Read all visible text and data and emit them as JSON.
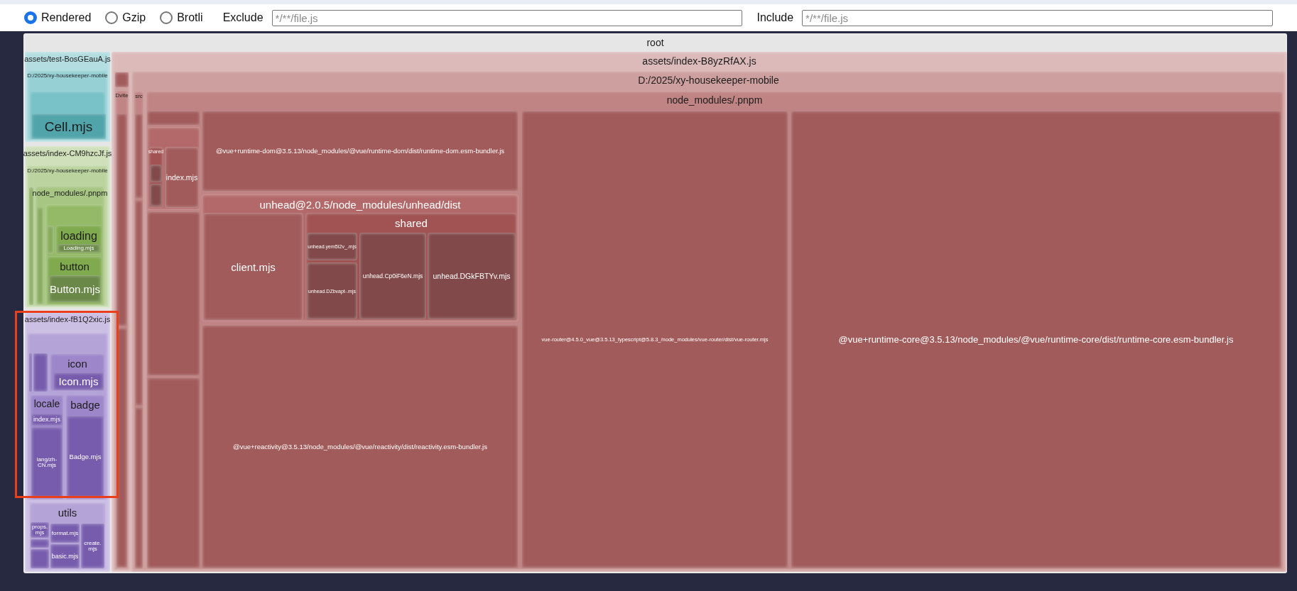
{
  "toolbar": {
    "size_options": [
      {
        "label": "Rendered",
        "selected": true
      },
      {
        "label": "Gzip",
        "selected": false
      },
      {
        "label": "Brotli",
        "selected": false
      }
    ],
    "filters": [
      {
        "label": "Exclude",
        "placeholder": "*/**/file.js"
      },
      {
        "label": "Include",
        "placeholder": "*/**/file.js"
      }
    ]
  },
  "treemap": {
    "root": {
      "kind": "folder",
      "label": "root",
      "children": [
        {
          "kind": "folder",
          "label": "assets/test-BosGEauA.js",
          "color": "#b3dde0",
          "highlighted": false,
          "children": [
            {
              "kind": "folder",
              "label": "D:/2025/xy-housekeeper-mobile",
              "children": [
                {
                  "kind": "folder",
                  "children": [
                    {
                      "kind": "module",
                      "label": "Cell.mjs"
                    }
                  ]
                }
              ]
            }
          ]
        },
        {
          "kind": "folder",
          "label": "assets/index-CM9hzcJf.js",
          "color": "#cfe0bb",
          "highlighted": false,
          "children": [
            {
              "kind": "folder",
              "label": "D:/2025/xy-housekeeper-mobile",
              "children": [
                {
                  "kind": "module"
                },
                {
                  "kind": "folder",
                  "label": "node_modules/.pnpm",
                  "children": [
                    {
                      "kind": "module"
                    },
                    {
                      "kind": "folder",
                      "children": [
                        {
                          "kind": "module"
                        },
                        {
                          "kind": "folder",
                          "label": "loading",
                          "children": [
                            {
                              "kind": "module",
                              "label": "Loading.mjs"
                            }
                          ]
                        },
                        {
                          "kind": "folder",
                          "label": "button",
                          "children": [
                            {
                              "kind": "module",
                              "label": "Button.mjs"
                            }
                          ]
                        }
                      ]
                    }
                  ]
                }
              ]
            }
          ]
        },
        {
          "kind": "folder",
          "label": "assets/index-fB1Q2xic.js",
          "color": "#cbbfe3",
          "highlighted": true,
          "children": [
            {
              "kind": "folder",
              "children": [
                {
                  "kind": "module"
                },
                {
                  "kind": "module"
                },
                {
                  "kind": "folder",
                  "label": "icon",
                  "children": [
                    {
                      "kind": "module",
                      "label": "Icon.mjs"
                    }
                  ]
                },
                {
                  "kind": "folder",
                  "label": "locale",
                  "children": [
                    {
                      "kind": "module",
                      "label": "index.mjs"
                    },
                    {
                      "kind": "module",
                      "label": "lang/zh-CN.mjs"
                    }
                  ]
                },
                {
                  "kind": "folder",
                  "label": "badge",
                  "children": [
                    {
                      "kind": "module",
                      "label": "Badge.mjs"
                    }
                  ]
                }
              ]
            },
            {
              "kind": "folder",
              "label": "utils",
              "children": [
                {
                  "kind": "module",
                  "label": "props.mjs"
                },
                {
                  "kind": "module"
                },
                {
                  "kind": "module"
                },
                {
                  "kind": "module",
                  "label": "format.mjs"
                },
                {
                  "kind": "module",
                  "label": "basic.mjs"
                },
                {
                  "kind": "module",
                  "label": "create.mjs"
                }
              ]
            }
          ]
        },
        {
          "kind": "folder",
          "label": "assets/index-B8yzRfAX.js",
          "color": "#dcbaba",
          "highlighted": false,
          "children": [
            {
              "kind": "folder",
              "children": [
                {
                  "kind": "module"
                },
                {
                  "kind": "folder",
                  "label": "Dvite",
                  "children": [
                    {
                      "kind": "module"
                    },
                    {
                      "kind": "module"
                    }
                  ]
                }
              ]
            },
            {
              "kind": "folder",
              "label": "D:/2025/xy-housekeeper-mobile",
              "children": [
                {
                  "kind": "folder",
                  "label": "src",
                  "children": [
                    {
                      "kind": "module"
                    },
                    {
                      "kind": "module"
                    },
                    {
                      "kind": "module"
                    }
                  ]
                },
                {
                  "kind": "folder",
                  "label": "node_modules/.pnpm",
                  "children": [
                    {
                      "kind": "module"
                    },
                    {
                      "kind": "folder",
                      "children": [
                        {
                          "kind": "folder",
                          "label": "shared",
                          "children": [
                            {
                              "kind": "module"
                            },
                            {
                              "kind": "module"
                            }
                          ]
                        },
                        {
                          "kind": "module",
                          "label": "index.mjs"
                        }
                      ]
                    },
                    {
                      "kind": "module"
                    },
                    {
                      "kind": "module"
                    },
                    {
                      "kind": "module",
                      "label": "@vue+runtime-dom@3.5.13/node_modules/@vue/runtime-dom/dist/runtime-dom.esm-bundler.js"
                    },
                    {
                      "kind": "folder",
                      "label": "unhead@2.0.5/node_modules/unhead/dist",
                      "children": [
                        {
                          "kind": "module",
                          "label": "client.mjs"
                        },
                        {
                          "kind": "folder",
                          "label": "shared",
                          "children": [
                            {
                              "kind": "module",
                              "label": "unhead.yem5I2v_.mjs"
                            },
                            {
                              "kind": "module",
                              "label": "unhead.DZbvapt-.mjs"
                            },
                            {
                              "kind": "module",
                              "label": "unhead.Cp0iF6eN.mjs"
                            },
                            {
                              "kind": "module",
                              "label": "unhead.DGkFBTYv.mjs"
                            }
                          ]
                        }
                      ]
                    },
                    {
                      "kind": "module",
                      "label": "@vue+reactivity@3.5.13/node_modules/@vue/reactivity/dist/reactivity.esm-bundler.js"
                    },
                    {
                      "kind": "module",
                      "label": "vue-router@4.5.0_vue@3.5.13_typescript@5.8.3_/node_modules/vue-router/dist/vue-router.mjs"
                    },
                    {
                      "kind": "module",
                      "label": "@vue+runtime-core@3.5.13/node_modules/@vue/runtime-core/dist/runtime-core.esm-bundler.js"
                    }
                  ]
                }
              ]
            }
          ]
        }
      ]
    }
  }
}
